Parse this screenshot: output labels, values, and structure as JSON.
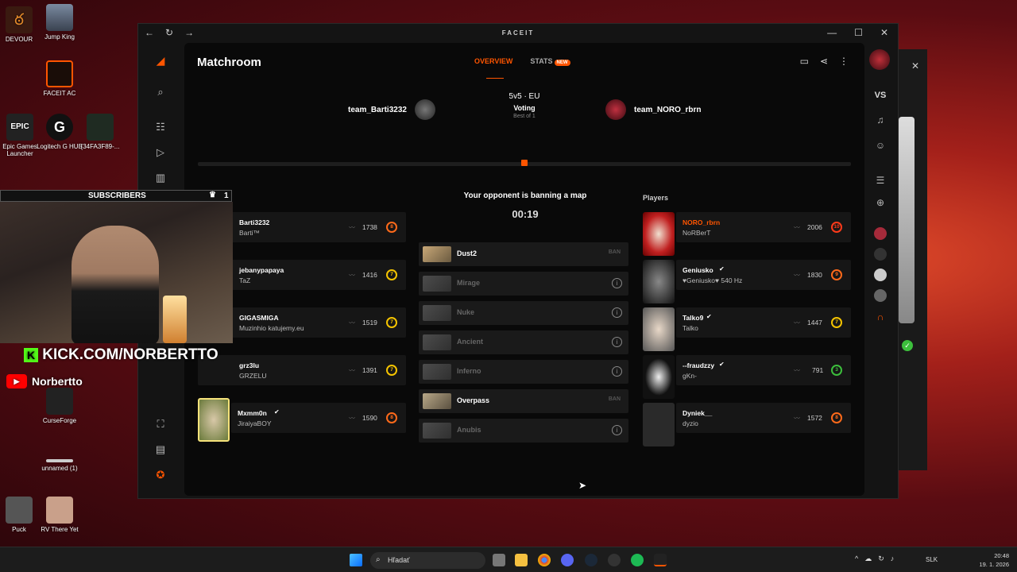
{
  "desktop": {
    "icons": [
      {
        "label": "DEVOUR"
      },
      {
        "label": "Jump King"
      },
      {
        "label": "FACEIT AC"
      },
      {
        "label": "Epic Games Launcher"
      },
      {
        "label": "Logitech G HUB"
      },
      {
        "label": "{34FA3F89-..."
      },
      {
        "label": "CurseForge"
      },
      {
        "label": "unnamed (1)"
      },
      {
        "label": "Puck"
      },
      {
        "label": "RV There Yet"
      }
    ]
  },
  "overlay": {
    "subscribers_label": "SUBSCRIBERS",
    "subscribers_count": "1",
    "kick_text": "KICK.COM/NORBERTTO",
    "youtube_name": "Norbertto"
  },
  "window": {
    "brand": "FACEIT",
    "title": "Matchroom",
    "tabs": [
      {
        "label": "OVERVIEW"
      },
      {
        "label": "STATS"
      }
    ],
    "new_badge": "NEW",
    "team1": "team_Barti3232",
    "team2": "team_NORO_rbrn",
    "format": "5v5 · EU",
    "status": "Voting",
    "best_of": "Best of 1",
    "players_label": "Players",
    "ban_title": "Your opponent is banning a map",
    "timer": "00:19",
    "right_sidebar_vs": "VS"
  },
  "team1_players": [
    {
      "name": "Barti3232",
      "sub": "Barti™",
      "elo": "1738",
      "level": "8"
    },
    {
      "name": "jebanypapaya",
      "sub": "TaZ",
      "elo": "1416",
      "level": "7"
    },
    {
      "name": "GIGASMIGA",
      "sub": "Muzinhio katujemy.eu",
      "elo": "1519",
      "level": "7"
    },
    {
      "name": "grz3lu",
      "sub": "GRZELU",
      "elo": "1391",
      "level": "7"
    },
    {
      "name": "Mxmm0n",
      "sub": "JiraiyaBOY",
      "elo": "1590",
      "level": "8"
    }
  ],
  "team2_players": [
    {
      "name": "NORO_rbrn",
      "sub": "NoRBerT",
      "elo": "2006",
      "level": "10"
    },
    {
      "name": "Geniusko",
      "sub": "♥Geniusko♥ 540 Hz",
      "elo": "1830",
      "level": "9"
    },
    {
      "name": "Talko9",
      "sub": "Talko",
      "elo": "1447",
      "level": "7"
    },
    {
      "name": "--fraudzzy",
      "sub": "gKn-",
      "elo": "791",
      "level": "3"
    },
    {
      "name": "Dyniek__",
      "sub": "dyzio",
      "elo": "1572",
      "level": "8"
    }
  ],
  "maps": [
    {
      "name": "Dust2",
      "state": "BAN"
    },
    {
      "name": "Mirage",
      "state": "i"
    },
    {
      "name": "Nuke",
      "state": "i"
    },
    {
      "name": "Ancient",
      "state": "i"
    },
    {
      "name": "Inferno",
      "state": "i"
    },
    {
      "name": "Overpass",
      "state": "BAN"
    },
    {
      "name": "Anubis",
      "state": "i"
    }
  ],
  "taskbar": {
    "search_placeholder": "Hľadať",
    "lang": "SLK",
    "time": "20:48",
    "date": "19. 1. 2026"
  },
  "colors": {
    "accent": "#ff5500",
    "level_yellow": "#f5c400",
    "level_orange": "#ff6a1a",
    "level_green": "#3cbf3c"
  }
}
